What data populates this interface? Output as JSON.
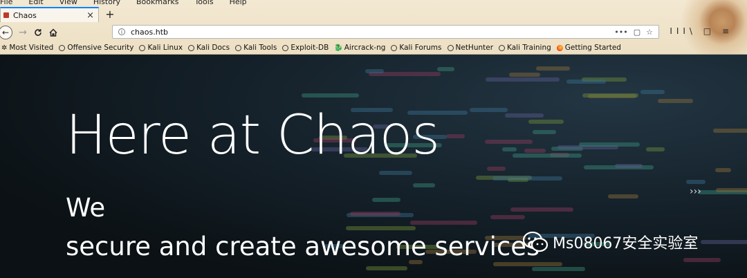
{
  "menu": [
    "File",
    "Edit",
    "View",
    "History",
    "Bookmarks",
    "Tools",
    "Help"
  ],
  "tab": {
    "title": "Chaos",
    "close": "×",
    "new_tab": "+"
  },
  "nav": {
    "back": "←",
    "forward": "→",
    "reload": "C",
    "home": "⌂"
  },
  "url": {
    "value": "chaos.htb",
    "more": "•••"
  },
  "toolbar_right": "III\\ □ ≡",
  "bookmarks": [
    {
      "label": "Most Visited",
      "icon": "gear-icon"
    },
    {
      "label": "Offensive Security",
      "icon": "globe-icon"
    },
    {
      "label": "Kali Linux",
      "icon": "globe-icon"
    },
    {
      "label": "Kali Docs",
      "icon": "globe-icon"
    },
    {
      "label": "Kali Tools",
      "icon": "globe-icon"
    },
    {
      "label": "Exploit-DB",
      "icon": "globe-icon"
    },
    {
      "label": "Aircrack-ng",
      "icon": "dragon-icon"
    },
    {
      "label": "Kali Forums",
      "icon": "globe-icon"
    },
    {
      "label": "NetHunter",
      "icon": "globe-icon"
    },
    {
      "label": "Kali Training",
      "icon": "globe-icon"
    },
    {
      "label": "Getting Started",
      "icon": "firefox-icon"
    }
  ],
  "hero": {
    "title": "Here at Chaos",
    "line1": "We",
    "line2": "secure and create awesome services",
    "next": "›››"
  },
  "watermark": "Ms08067安全实验室"
}
